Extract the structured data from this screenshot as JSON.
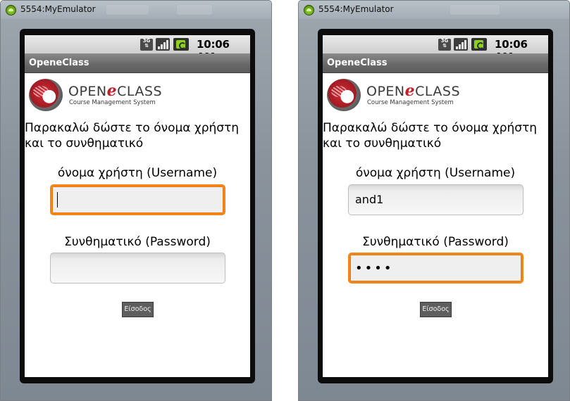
{
  "window": {
    "title": "5554:MyEmulator"
  },
  "status_bar": {
    "network": "3G",
    "time": "10:06 AM"
  },
  "app": {
    "title": "OpeneClass"
  },
  "logo": {
    "name_open": "OPEN",
    "name_e": "e",
    "name_class": "CLASS",
    "tagline": "Course Management System"
  },
  "form": {
    "prompt": "Παρακαλώ δώστε το όνομα χρήστη και το συνθηματικό",
    "username_label": "όνομα χρήστη (Username)",
    "password_label": "Συνθηματικό (Password)",
    "login_button": "Είσοδος"
  },
  "screens": [
    {
      "username_value": "",
      "password_value": "",
      "focused_field": "username"
    },
    {
      "username_value": "and1",
      "password_value": "••••",
      "focused_field": "password"
    }
  ],
  "colors": {
    "focus_border": "#f0861c",
    "appbar": "#6a6a6a",
    "logo_red": "#c0202a"
  }
}
